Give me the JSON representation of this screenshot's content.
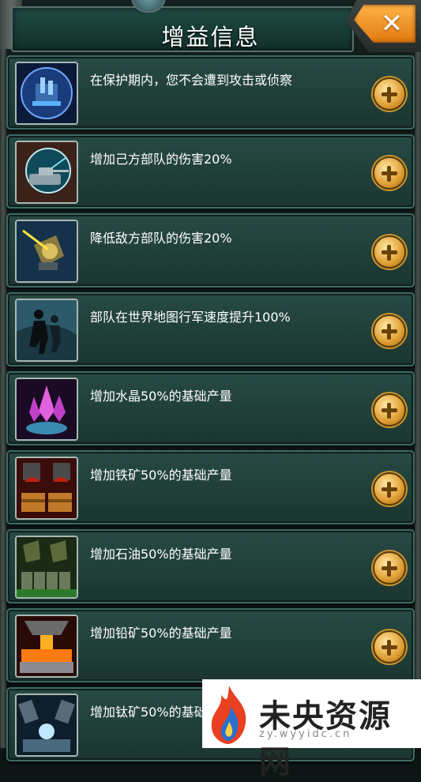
{
  "header": {
    "title": "增益信息",
    "close_symbol": "✕"
  },
  "buffs": [
    {
      "icon": "shield-base-icon",
      "text": "在保护期内，您不会遭到攻击或侦察"
    },
    {
      "icon": "tank-radar-icon",
      "text": "增加己方部队的伤害20%"
    },
    {
      "icon": "turret-laser-icon",
      "text": "降低敌方部队的伤害20%"
    },
    {
      "icon": "running-soldiers-icon",
      "text": "部队在世界地图行军速度提升100%"
    },
    {
      "icon": "crystal-icon",
      "text": "增加水晶50%的基础产量"
    },
    {
      "icon": "iron-ore-icon",
      "text": "增加铁矿50%的基础产量"
    },
    {
      "icon": "oil-barrels-icon",
      "text": "增加石油50%的基础产量"
    },
    {
      "icon": "lead-ore-icon",
      "text": "增加铅矿50%的基础产量"
    },
    {
      "icon": "titanium-ore-icon",
      "text": "增加钛矿50%的基础产量"
    }
  ],
  "watermark": {
    "text": "未央资源网",
    "url": "zy.wyyidc.cn"
  },
  "colors": {
    "panel": "#1b3530",
    "border": "#3d6a62",
    "accent": "#e3a43a",
    "close": "#e07a10"
  }
}
